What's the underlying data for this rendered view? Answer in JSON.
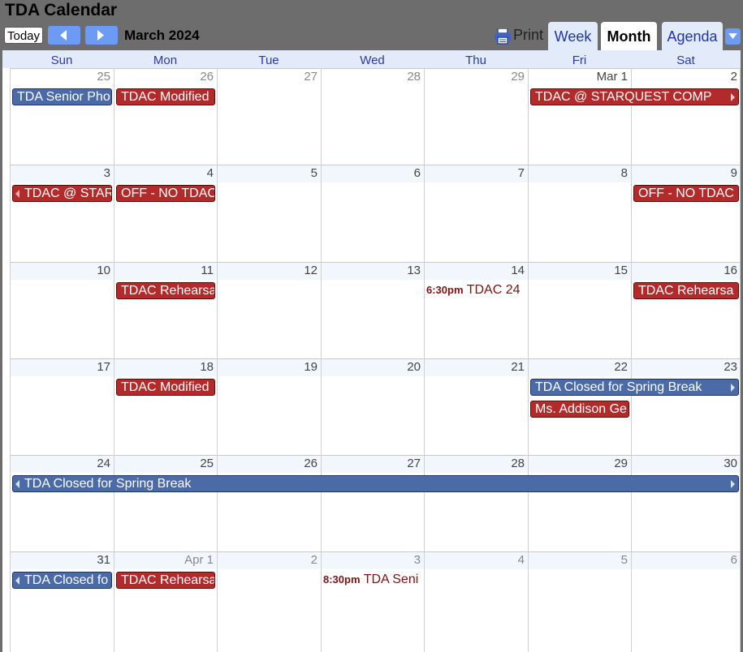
{
  "app": {
    "title": "TDA Calendar"
  },
  "toolbar": {
    "today_label": "Today",
    "period_label": "March 2024",
    "print_label": "Print"
  },
  "tabs": {
    "week": "Week",
    "month": "Month",
    "agenda": "Agenda",
    "active": "Month"
  },
  "icons": {
    "prev": "chevron-left-icon",
    "next": "chevron-right-icon",
    "print": "printer-icon",
    "dropdown": "caret-down-icon"
  },
  "colors": {
    "event_red": "#b32a2a",
    "event_blue": "#4a6aa8",
    "nav_blue": "#6c9bf5",
    "header_gray": "#6d6d6d"
  },
  "weekdays": [
    "Sun",
    "Mon",
    "Tue",
    "Wed",
    "Thu",
    "Fri",
    "Sat"
  ],
  "weeks": [
    [
      {
        "label": "25",
        "other": true
      },
      {
        "label": "26",
        "other": true
      },
      {
        "label": "27",
        "other": true
      },
      {
        "label": "28",
        "other": true
      },
      {
        "label": "29",
        "other": true
      },
      {
        "label": "Mar 1",
        "other": false
      },
      {
        "label": "2",
        "other": false
      }
    ],
    [
      {
        "label": "3"
      },
      {
        "label": "4"
      },
      {
        "label": "5"
      },
      {
        "label": "6"
      },
      {
        "label": "7"
      },
      {
        "label": "8"
      },
      {
        "label": "9"
      }
    ],
    [
      {
        "label": "10"
      },
      {
        "label": "11"
      },
      {
        "label": "12"
      },
      {
        "label": "13"
      },
      {
        "label": "14"
      },
      {
        "label": "15"
      },
      {
        "label": "16"
      }
    ],
    [
      {
        "label": "17"
      },
      {
        "label": "18"
      },
      {
        "label": "19"
      },
      {
        "label": "20"
      },
      {
        "label": "21"
      },
      {
        "label": "22"
      },
      {
        "label": "23"
      }
    ],
    [
      {
        "label": "24"
      },
      {
        "label": "25"
      },
      {
        "label": "26"
      },
      {
        "label": "27"
      },
      {
        "label": "28"
      },
      {
        "label": "29"
      },
      {
        "label": "30"
      }
    ],
    [
      {
        "label": "31"
      },
      {
        "label": "Apr 1",
        "other": true
      },
      {
        "label": "2",
        "other": true
      },
      {
        "label": "3",
        "other": true
      },
      {
        "label": "4",
        "other": true
      },
      {
        "label": "5",
        "other": true
      },
      {
        "label": "6",
        "other": true
      }
    ]
  ],
  "events": [
    {
      "week": 0,
      "day": 0,
      "span": 1,
      "row": 0,
      "title": "TDA Senior Pho",
      "color": "blue"
    },
    {
      "week": 0,
      "day": 1,
      "span": 1,
      "row": 0,
      "title": "TDAC Modified",
      "color": "red"
    },
    {
      "week": 0,
      "day": 5,
      "span": 2,
      "row": 0,
      "title": "TDAC @ STARQUEST COMP",
      "color": "red",
      "contR": true
    },
    {
      "week": 1,
      "day": 0,
      "span": 1,
      "row": 0,
      "title": "TDAC @ STAR",
      "color": "red",
      "contL": true
    },
    {
      "week": 1,
      "day": 1,
      "span": 1,
      "row": 0,
      "title": "OFF - NO TDAC",
      "color": "red"
    },
    {
      "week": 1,
      "day": 6,
      "span": 1,
      "row": 0,
      "title": "OFF - NO TDAC",
      "color": "red"
    },
    {
      "week": 2,
      "day": 1,
      "span": 1,
      "row": 0,
      "title": "TDAC Rehearsa",
      "color": "red"
    },
    {
      "week": 2,
      "day": 4,
      "span": 1,
      "row": 0,
      "time": "6:30pm",
      "title": "TDAC 24",
      "timed": true
    },
    {
      "week": 2,
      "day": 6,
      "span": 1,
      "row": 0,
      "title": "TDAC Rehearsa",
      "color": "red"
    },
    {
      "week": 3,
      "day": 1,
      "span": 1,
      "row": 0,
      "title": "TDAC Modified",
      "color": "red"
    },
    {
      "week": 3,
      "day": 5,
      "span": 2,
      "row": 0,
      "title": "TDA Closed for Spring Break",
      "color": "blue",
      "contR": true
    },
    {
      "week": 3,
      "day": 5,
      "span": 1,
      "row": 1,
      "title": "Ms. Addison Ge",
      "color": "red"
    },
    {
      "week": 4,
      "day": 0,
      "span": 7,
      "row": 0,
      "title": "TDA Closed for Spring Break",
      "color": "blue",
      "contL": true,
      "contR": true
    },
    {
      "week": 5,
      "day": 0,
      "span": 1,
      "row": 0,
      "title": "TDA Closed fo",
      "color": "blue",
      "contL": true
    },
    {
      "week": 5,
      "day": 1,
      "span": 1,
      "row": 0,
      "title": "TDAC Rehearsa",
      "color": "red"
    },
    {
      "week": 5,
      "day": 3,
      "span": 1,
      "row": 0,
      "time": "8:30pm",
      "title": "TDA Seni",
      "timed": true
    }
  ]
}
